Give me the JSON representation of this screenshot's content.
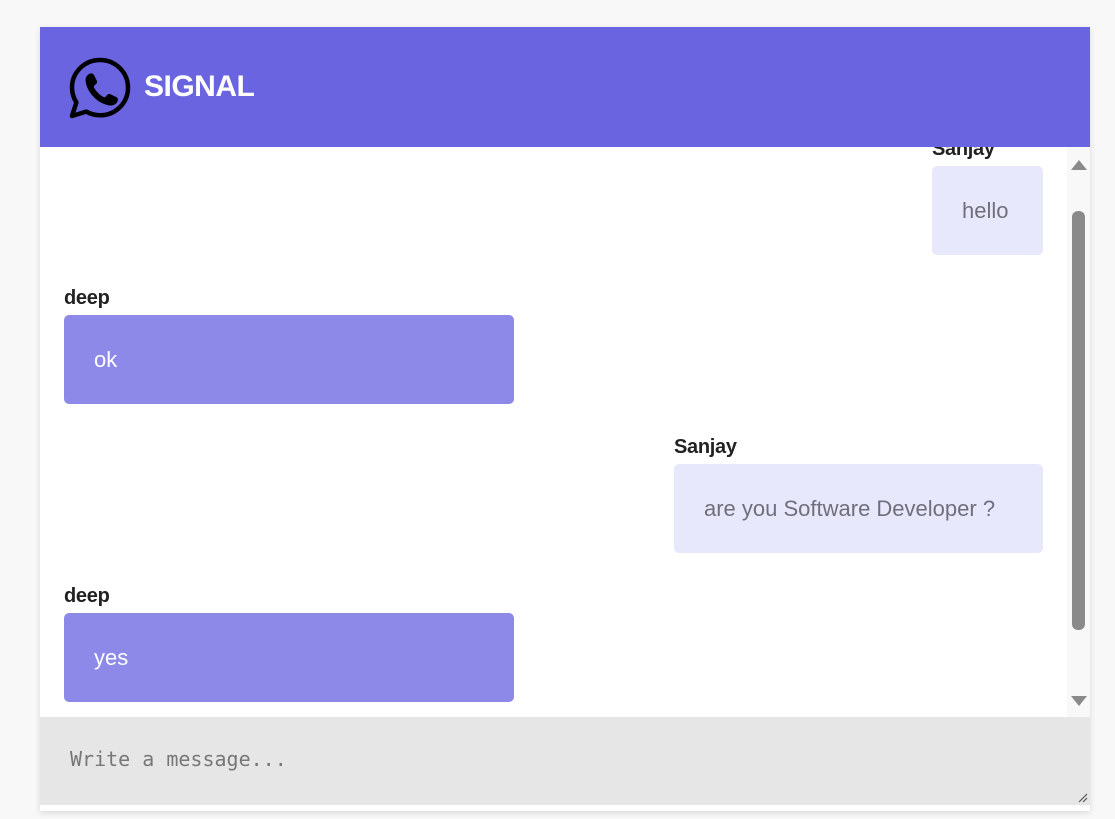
{
  "header": {
    "title": "SIGNAL",
    "logo_icon": "whatsapp-phone-icon",
    "bg_color": "#6a64e0"
  },
  "messages": [
    {
      "sender": "Sanjay",
      "text": "hello",
      "direction": "sent"
    },
    {
      "sender": "deep",
      "text": "ok",
      "direction": "received"
    },
    {
      "sender": "Sanjay",
      "text": "are you Software Developer ?",
      "direction": "sent"
    },
    {
      "sender": "deep",
      "text": "yes",
      "direction": "received"
    }
  ],
  "composer": {
    "placeholder": "Write a message...",
    "value": ""
  },
  "colors": {
    "sent_bubble": "#e8e8fc",
    "received_bubble": "#8c89e8",
    "composer_bg": "#e6e6e6"
  }
}
